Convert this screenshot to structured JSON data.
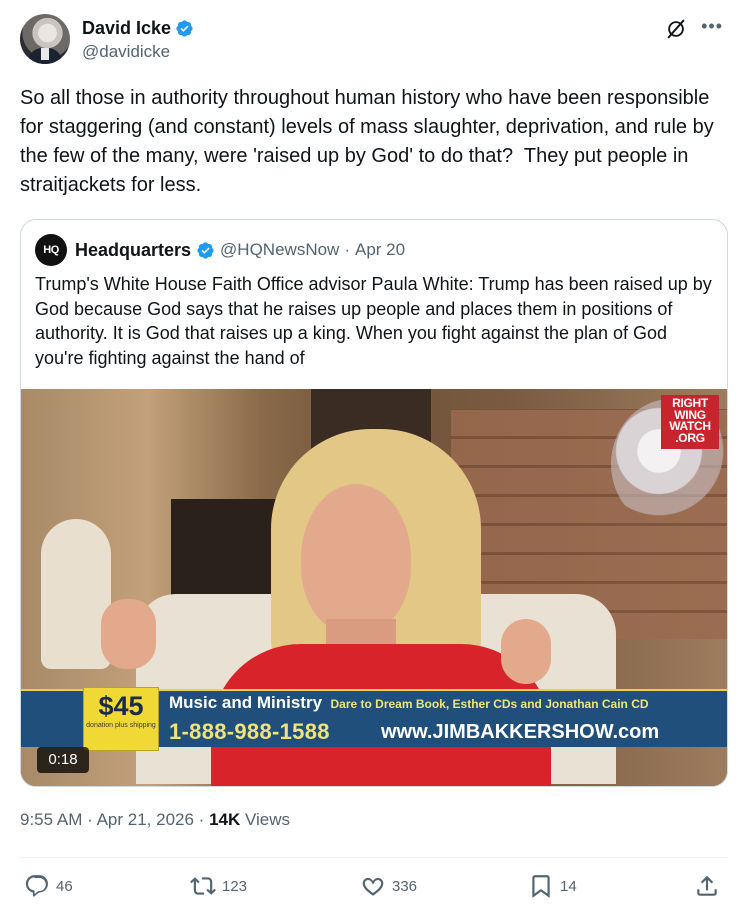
{
  "author": {
    "display_name": "David Icke",
    "handle": "@davidicke",
    "verified": true,
    "avatar": "profile-photo"
  },
  "icons": {
    "verified": "verified-badge-icon",
    "grok": "grok-icon",
    "more": "more-icon"
  },
  "tweet": {
    "text": "So all those in authority throughout human history who have been responsible for staggering (and constant) levels of mass slaughter, deprivation, and rule by the few of the many, were 'raised up by God' to do that?  They put people in straitjackets for less."
  },
  "quoted": {
    "logo_text": "HQ",
    "display_name": "Headquarters",
    "handle": "@HQNewsNow",
    "separator": "·",
    "date": "Apr 20",
    "text": "Trump's White House Faith Office advisor Paula White: Trump has been raised up by God because God says that he raises up people and places them in positions of authority. It is God that raises up a king. When you fight against the plan of God you're fighting against the hand of",
    "media": {
      "type": "video",
      "duration": "0:18",
      "watermark": [
        "RIGHT",
        "WING",
        "WATCH",
        ".ORG"
      ],
      "banner": {
        "price": "$45",
        "price_sub": "donation plus shipping",
        "title": "Music and Ministry",
        "subtitle": "Dare to Dream Book, Esther CDs and Jonathan Cain CD",
        "phone": "1-888-988-1588",
        "url": "www.JIMBAKKERSHOW.com"
      }
    }
  },
  "meta": {
    "time": "9:55 AM",
    "separator": "·",
    "date": "Apr 21, 2026",
    "views_count": "14K",
    "views_label": "Views"
  },
  "actions": {
    "replies": "46",
    "reposts": "123",
    "likes": "336",
    "bookmarks": "14"
  },
  "colors": {
    "text": "#0f1419",
    "secondary": "#536471",
    "verified_blue": "#1d9bf0",
    "border": "#cfd9de",
    "banner_blue": "#1f4f7a",
    "banner_yellow": "#f1d935",
    "rww_red": "#c8242d",
    "dress_red": "#d8232a"
  }
}
